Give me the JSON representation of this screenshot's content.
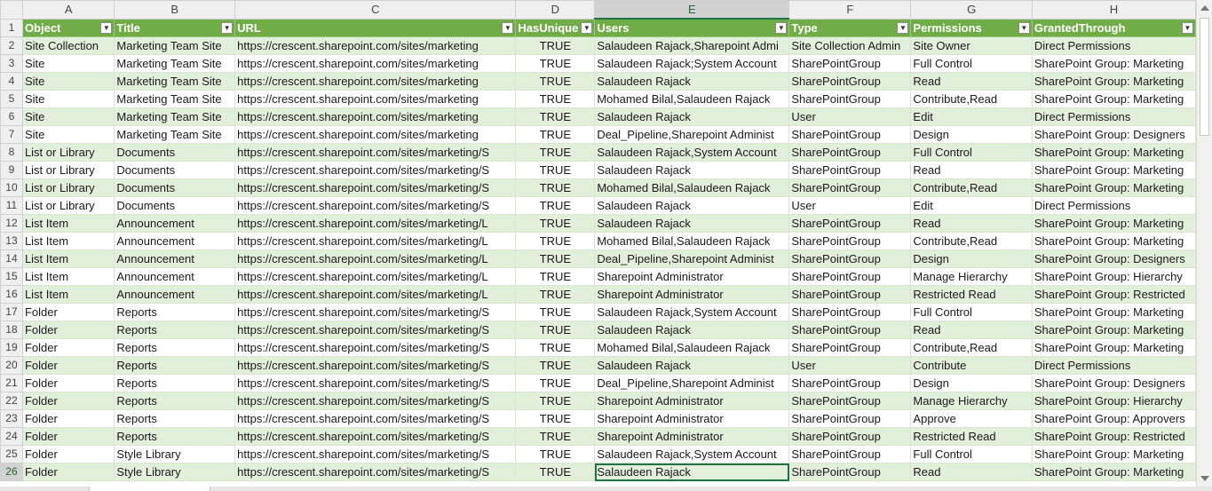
{
  "columns": [
    "A",
    "B",
    "C",
    "D",
    "E",
    "F",
    "G",
    "H"
  ],
  "selected_column": "E",
  "selected_row": "26",
  "headers": [
    "Object",
    "Title",
    "URL",
    "HasUnique",
    "Users",
    "Type",
    "Permissions",
    "GrantedThrough"
  ],
  "filter_icon": "dropdown-arrow-icon",
  "colors": {
    "header_green": "#70ad47",
    "band_green": "#e2efda",
    "select_green": "#217346"
  },
  "rows": [
    {
      "n": "2",
      "cells": [
        "Site Collection",
        "Marketing Team Site",
        "https://crescent.sharepoint.com/sites/marketing",
        "TRUE",
        "Salaudeen Rajack,Sharepoint Admi",
        "Site Collection Admin",
        "Site Owner",
        "Direct Permissions"
      ]
    },
    {
      "n": "3",
      "cells": [
        "Site",
        "Marketing Team Site",
        "https://crescent.sharepoint.com/sites/marketing",
        "TRUE",
        "Salaudeen Rajack;System Account",
        "SharePointGroup",
        "Full Control",
        "SharePoint Group: Marketing"
      ]
    },
    {
      "n": "4",
      "cells": [
        "Site",
        "Marketing Team Site",
        "https://crescent.sharepoint.com/sites/marketing",
        "TRUE",
        "Salaudeen Rajack",
        "SharePointGroup",
        "Read",
        "SharePoint Group: Marketing"
      ]
    },
    {
      "n": "5",
      "cells": [
        "Site",
        "Marketing Team Site",
        "https://crescent.sharepoint.com/sites/marketing",
        "TRUE",
        "Mohamed Bilal,Salaudeen Rajack",
        "SharePointGroup",
        "Contribute,Read",
        "SharePoint Group: Marketing"
      ]
    },
    {
      "n": "6",
      "cells": [
        "Site",
        "Marketing Team Site",
        "https://crescent.sharepoint.com/sites/marketing",
        "TRUE",
        "Salaudeen Rajack",
        "User",
        "Edit",
        "Direct Permissions"
      ]
    },
    {
      "n": "7",
      "cells": [
        "Site",
        "Marketing Team Site",
        "https://crescent.sharepoint.com/sites/marketing",
        "TRUE",
        "Deal_Pipeline,Sharepoint Administ",
        "SharePointGroup",
        "Design",
        "SharePoint Group: Designers"
      ]
    },
    {
      "n": "8",
      "cells": [
        "List or Library",
        "Documents",
        "https://crescent.sharepoint.com/sites/marketing/S",
        "TRUE",
        "Salaudeen Rajack,System Account",
        "SharePointGroup",
        "Full Control",
        "SharePoint Group: Marketing"
      ]
    },
    {
      "n": "9",
      "cells": [
        "List or Library",
        "Documents",
        "https://crescent.sharepoint.com/sites/marketing/S",
        "TRUE",
        "Salaudeen Rajack",
        "SharePointGroup",
        "Read",
        "SharePoint Group: Marketing"
      ]
    },
    {
      "n": "10",
      "cells": [
        "List or Library",
        "Documents",
        "https://crescent.sharepoint.com/sites/marketing/S",
        "TRUE",
        "Mohamed Bilal,Salaudeen Rajack",
        "SharePointGroup",
        "Contribute,Read",
        "SharePoint Group: Marketing"
      ]
    },
    {
      "n": "11",
      "cells": [
        "List or Library",
        "Documents",
        "https://crescent.sharepoint.com/sites/marketing/S",
        "TRUE",
        "Salaudeen Rajack",
        "User",
        "Edit",
        "Direct Permissions"
      ]
    },
    {
      "n": "12",
      "cells": [
        "List Item",
        "Announcement",
        "https://crescent.sharepoint.com/sites/marketing/L",
        "TRUE",
        "Salaudeen Rajack",
        "SharePointGroup",
        "Read",
        "SharePoint Group: Marketing"
      ]
    },
    {
      "n": "13",
      "cells": [
        "List Item",
        "Announcement",
        "https://crescent.sharepoint.com/sites/marketing/L",
        "TRUE",
        "Mohamed Bilal,Salaudeen Rajack",
        "SharePointGroup",
        "Contribute,Read",
        "SharePoint Group: Marketing"
      ]
    },
    {
      "n": "14",
      "cells": [
        "List Item",
        "Announcement",
        "https://crescent.sharepoint.com/sites/marketing/L",
        "TRUE",
        "Deal_Pipeline,Sharepoint Administ",
        "SharePointGroup",
        "Design",
        "SharePoint Group: Designers"
      ]
    },
    {
      "n": "15",
      "cells": [
        "List Item",
        "Announcement",
        "https://crescent.sharepoint.com/sites/marketing/L",
        "TRUE",
        "Sharepoint Administrator",
        "SharePointGroup",
        "Manage Hierarchy",
        "SharePoint Group: Hierarchy"
      ]
    },
    {
      "n": "16",
      "cells": [
        "List Item",
        "Announcement",
        "https://crescent.sharepoint.com/sites/marketing/L",
        "TRUE",
        "Sharepoint Administrator",
        "SharePointGroup",
        "Restricted Read",
        "SharePoint Group: Restricted"
      ]
    },
    {
      "n": "17",
      "cells": [
        "Folder",
        "Reports",
        "https://crescent.sharepoint.com/sites/marketing/S",
        "TRUE",
        "Salaudeen Rajack,System Account",
        "SharePointGroup",
        "Full Control",
        "SharePoint Group: Marketing"
      ]
    },
    {
      "n": "18",
      "cells": [
        "Folder",
        "Reports",
        "https://crescent.sharepoint.com/sites/marketing/S",
        "TRUE",
        "Salaudeen Rajack",
        "SharePointGroup",
        "Read",
        "SharePoint Group: Marketing"
      ]
    },
    {
      "n": "19",
      "cells": [
        "Folder",
        "Reports",
        "https://crescent.sharepoint.com/sites/marketing/S",
        "TRUE",
        "Mohamed Bilal,Salaudeen Rajack",
        "SharePointGroup",
        "Contribute,Read",
        "SharePoint Group: Marketing"
      ]
    },
    {
      "n": "20",
      "cells": [
        "Folder",
        "Reports",
        "https://crescent.sharepoint.com/sites/marketing/S",
        "TRUE",
        "Salaudeen Rajack",
        "User",
        "Contribute",
        "Direct Permissions"
      ]
    },
    {
      "n": "21",
      "cells": [
        "Folder",
        "Reports",
        "https://crescent.sharepoint.com/sites/marketing/S",
        "TRUE",
        "Deal_Pipeline,Sharepoint Administ",
        "SharePointGroup",
        "Design",
        "SharePoint Group: Designers"
      ]
    },
    {
      "n": "22",
      "cells": [
        "Folder",
        "Reports",
        "https://crescent.sharepoint.com/sites/marketing/S",
        "TRUE",
        "Sharepoint Administrator",
        "SharePointGroup",
        "Manage Hierarchy",
        "SharePoint Group: Hierarchy"
      ]
    },
    {
      "n": "23",
      "cells": [
        "Folder",
        "Reports",
        "https://crescent.sharepoint.com/sites/marketing/S",
        "TRUE",
        "Sharepoint Administrator",
        "SharePointGroup",
        "Approve",
        "SharePoint Group: Approvers"
      ]
    },
    {
      "n": "24",
      "cells": [
        "Folder",
        "Reports",
        "https://crescent.sharepoint.com/sites/marketing/S",
        "TRUE",
        "Sharepoint Administrator",
        "SharePointGroup",
        "Restricted Read",
        "SharePoint Group: Restricted"
      ]
    },
    {
      "n": "25",
      "cells": [
        "Folder",
        "Style Library",
        "https://crescent.sharepoint.com/sites/marketing/S",
        "TRUE",
        "Salaudeen Rajack,System Account",
        "SharePointGroup",
        "Full Control",
        "SharePoint Group: Marketing"
      ]
    },
    {
      "n": "26",
      "cells": [
        "Folder",
        "Style Library",
        "https://crescent.sharepoint.com/sites/marketing/S",
        "TRUE",
        "Salaudeen Rajack",
        "SharePointGroup",
        "Read",
        "SharePoint Group: Marketing"
      ]
    }
  ]
}
